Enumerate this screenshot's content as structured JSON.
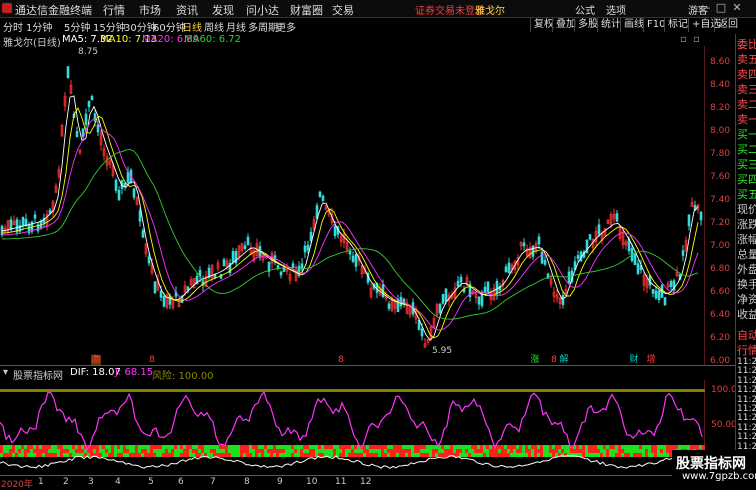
{
  "topbar": {
    "app_title": "通达信金融终端",
    "menus": [
      "行情",
      "市场",
      "资讯",
      "发现",
      "问小达",
      "财富圈",
      "交易"
    ],
    "alert": "证券交易未登录",
    "stock_name": "雅戈尔",
    "right_items": [
      "公式",
      "选项",
      "游客"
    ],
    "window_buttons": [
      "—",
      "□",
      "✕"
    ]
  },
  "toolbar": {
    "periods": [
      "分时",
      "1分钟",
      "5分钟",
      "15分钟",
      "30分钟",
      "60分钟",
      "日线",
      "周线",
      "月线",
      "多周期",
      "更多"
    ],
    "active_period": "日线",
    "right_items": [
      "复权",
      "叠加",
      "多股",
      "统计",
      "画线",
      "F10",
      "标记",
      "+自选",
      "返回"
    ],
    "accent": "#ffd24a"
  },
  "main_info": {
    "title": "雅戈尔(日线)",
    "ma5": "MA5: 7.32",
    "ma10": "MA10: 7.13",
    "ma20": "MA20: 6.89",
    "ma60": "MA60: 6.72",
    "colors": {
      "ma5": "#ffffff",
      "ma10": "#ffff00",
      "ma20": "#ff33ff",
      "ma60": "#33cc33"
    }
  },
  "price_axis": [
    "8.60",
    "8.40",
    "8.20",
    "8.00",
    "7.80",
    "7.60",
    "7.40",
    "7.20",
    "7.00",
    "6.80",
    "6.60",
    "6.40",
    "6.20",
    "6.00"
  ],
  "price_labels": {
    "high": "8.75",
    "low": "5.95"
  },
  "indicator": {
    "name": "股票指标网",
    "dif": "DIF: 18.07",
    "j": "J: 68.15",
    "risk": "风险: 100.00",
    "axis": [
      "100.0",
      "50.00"
    ]
  },
  "time_axis": {
    "year": "2020年",
    "months": [
      "1",
      "2",
      "3",
      "4",
      "5",
      "6",
      "7",
      "8",
      "9",
      "10",
      "11",
      "12"
    ]
  },
  "markers": [
    {
      "text": "激",
      "color": "#ff3d3d"
    },
    {
      "text": "8",
      "color": "#ff3d3d"
    },
    {
      "text": "8",
      "color": "#ff3d3d"
    },
    {
      "text": "涨",
      "color": "#2ee62e"
    },
    {
      "text": "8",
      "color": "#ff3d3d"
    },
    {
      "text": "解",
      "color": "#00cccc"
    },
    {
      "text": "财",
      "color": "#00cccc"
    },
    {
      "text": "增",
      "color": "#ff3d3d"
    }
  ],
  "right_panel": {
    "items": [
      "委比",
      "卖五",
      "卖四",
      "卖三",
      "卖二",
      "卖一",
      "买一",
      "买二",
      "买三",
      "买四",
      "买五",
      "现价",
      "涨跌",
      "涨幅",
      "总量",
      "外盘",
      "换手",
      "净资",
      "收益",
      "自动",
      "行情"
    ],
    "times": [
      "11:25",
      "11:25",
      "11:25",
      "11:25",
      "11:25",
      "11:25",
      "11:25",
      "11:25",
      "11:25",
      "11:25",
      "11:25",
      "11:25",
      "11:25"
    ]
  },
  "watermark": {
    "title": "股票指标网",
    "url": "www.7gpzb.com"
  }
}
